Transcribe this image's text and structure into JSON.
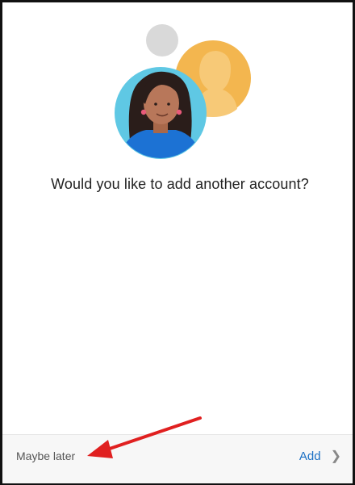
{
  "prompt": {
    "question": "Would you like to add another account?"
  },
  "footer": {
    "maybe_later_label": "Maybe later",
    "add_label": "Add"
  },
  "icons": {
    "chevron": "chevron-right-icon"
  },
  "colors": {
    "accent": "#1a6fc4",
    "annotation_arrow": "#e02020",
    "avatar_bg": "#6ecde6",
    "avatar_shirt": "#1c7ed6",
    "secondary_avatar": "#f3b64f"
  }
}
